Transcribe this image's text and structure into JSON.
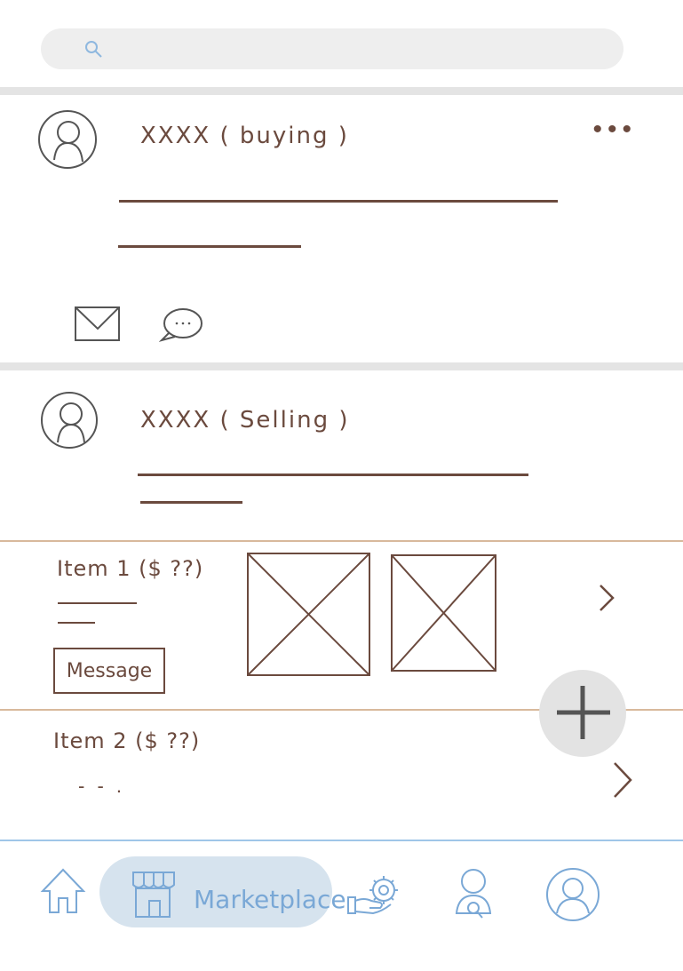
{
  "search": {
    "placeholder": ""
  },
  "posts": [
    {
      "title": "XXXX ( buying )"
    },
    {
      "title": "XXXX ( Selling )"
    }
  ],
  "items": [
    {
      "title": "Item 1  ($ ??)",
      "message_label": "Message"
    },
    {
      "title": "Item 2  ($ ??)",
      "ellipsis": "- - ."
    }
  ],
  "more_label": "•••",
  "nav": {
    "marketplace_label": "Marketplace"
  },
  "colors": {
    "ink": "#6b4a3e",
    "nav_blue": "#7aa8d6",
    "nav_active_bg": "#d6e3ee",
    "separator_tan": "#d8b99c"
  },
  "icons": [
    "search-icon",
    "avatar-icon",
    "more-icon",
    "mail-icon",
    "chat-icon",
    "image-placeholder-icon",
    "chevron-right-icon",
    "plus-icon",
    "home-icon",
    "store-icon",
    "hand-gear-icon",
    "person-search-icon",
    "profile-icon"
  ]
}
